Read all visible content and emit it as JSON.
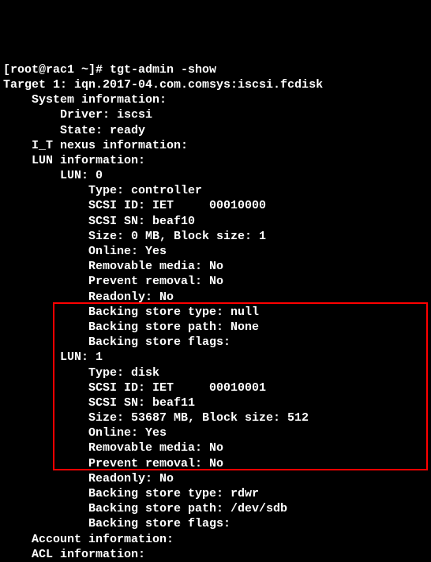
{
  "prompt": "[root@rac1 ~]# ",
  "command": "tgt-admin -show",
  "target_header": "Target 1: iqn.2017-04.com.comsys:iscsi.fcdisk",
  "sections": {
    "system_info": "    System information:",
    "driver": "        Driver: iscsi",
    "state": "        State: ready",
    "it_nexus": "    I_T nexus information:",
    "lun_info": "    LUN information:",
    "lun0_header": "        LUN: 0",
    "lun0_type": "            Type: controller",
    "lun0_scsi_id": "            SCSI ID: IET     00010000",
    "lun0_scsi_sn": "            SCSI SN: beaf10",
    "lun0_size": "            Size: 0 MB, Block size: 1",
    "lun0_online": "            Online: Yes",
    "lun0_removable": "            Removable media: No",
    "lun0_prevent": "            Prevent removal: No",
    "lun0_readonly": "            Readonly: No",
    "lun0_bs_type": "            Backing store type: null",
    "lun0_bs_path": "            Backing store path: None",
    "lun0_bs_flags": "            Backing store flags: ",
    "lun1_header": "        LUN: 1",
    "lun1_type": "            Type: disk",
    "lun1_scsi_id": "            SCSI ID: IET     00010001",
    "lun1_scsi_sn": "            SCSI SN: beaf11",
    "lun1_size": "            Size: 53687 MB, Block size: 512",
    "lun1_online": "            Online: Yes",
    "lun1_removable": "            Removable media: No",
    "lun1_prevent": "            Prevent removal: No",
    "lun1_readonly": "            Readonly: No",
    "lun1_bs_type": "            Backing store type: rdwr",
    "lun1_bs_path": "            Backing store path: /dev/sdb",
    "lun1_bs_flags": "            Backing store flags: ",
    "account_info": "    Account information:",
    "acl_info": "    ACL information:"
  }
}
